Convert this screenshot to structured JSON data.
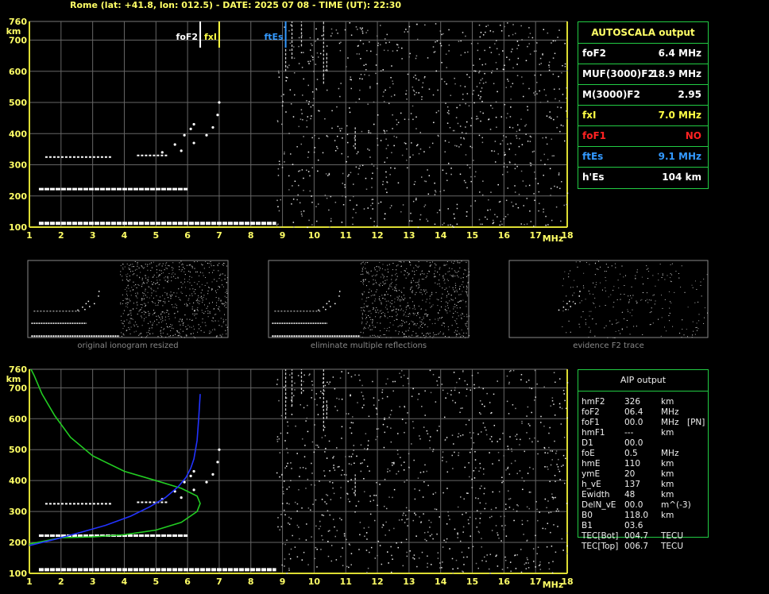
{
  "header": {
    "title": "Rome (lat: +41.8, lon: 012.5) - DATE: 2025 07 08 - TIME (UT): 22:30"
  },
  "autoscala": {
    "title": "AUTOSCALA output",
    "rows": [
      {
        "key": "foF2",
        "value": "6.4 MHz",
        "color": "#ffffff"
      },
      {
        "key": "MUF(3000)F2",
        "value": "18.9 MHz",
        "color": "#ffffff"
      },
      {
        "key": "M(3000)F2",
        "value": "2.95",
        "color": "#ffffff"
      },
      {
        "key": "fxI",
        "value": "7.0 MHz",
        "color": "#ffff44"
      },
      {
        "key": "foF1",
        "value": "NO",
        "color": "#ff2222"
      },
      {
        "key": "ftEs",
        "value": "9.1 MHz",
        "color": "#3399ff"
      },
      {
        "key": "h'Es",
        "value": "104    km",
        "color": "#ffffff"
      }
    ]
  },
  "aip": {
    "title": "AIP output",
    "rows": [
      [
        "hmF2",
        "326",
        "km",
        ""
      ],
      [
        "foF2",
        "06.4",
        "MHz",
        ""
      ],
      [
        "foF1",
        "00.0",
        "MHz",
        "[PN]"
      ],
      [
        "hmF1",
        "---",
        "km",
        ""
      ],
      [
        "D1",
        "00.0",
        "",
        ""
      ],
      [
        "foE",
        "0.5",
        "MHz",
        ""
      ],
      [
        "hmE",
        "110",
        "km",
        ""
      ],
      [
        "ymE",
        "20",
        "km",
        ""
      ],
      [
        "h_vE",
        "137",
        "km",
        ""
      ],
      [
        "Ewidth",
        "48",
        "km",
        ""
      ],
      [
        "DelN_vE",
        "00.0",
        "m^(-3)",
        ""
      ],
      [
        "B0",
        "118.0",
        "km",
        ""
      ],
      [
        "B1",
        "03.6",
        "",
        ""
      ],
      [
        "TEC[Bot]",
        "004.7",
        "TECU",
        ""
      ],
      [
        "TEC[Top]",
        "006.7",
        "TECU",
        ""
      ]
    ]
  },
  "thumbnails": {
    "captions": [
      "original ionogram resized",
      "eliminate multiple reflections",
      "evidence F2 trace"
    ]
  },
  "chart_data": [
    {
      "type": "scatter",
      "title": "",
      "xlabel": "MHz",
      "ylabel": "km",
      "xlim": [
        1,
        18
      ],
      "ylim": [
        100,
        760
      ],
      "x_ticks": [
        1,
        2,
        3,
        4,
        5,
        6,
        7,
        8,
        9,
        10,
        11,
        12,
        13,
        14,
        15,
        16,
        17,
        18
      ],
      "y_ticks": [
        100,
        200,
        300,
        400,
        500,
        600,
        700,
        760
      ],
      "grid": true,
      "markers": [
        {
          "name": "foF2",
          "x": 6.4,
          "color": "#ffffff"
        },
        {
          "name": "fxI",
          "x": 7.0,
          "color": "#ffff44"
        },
        {
          "name": "ftEs",
          "x": 9.1,
          "color": "#3399ff"
        }
      ],
      "traces": [
        {
          "x": [
            1.3,
            8.8
          ],
          "y": 112
        },
        {
          "x": [
            1.3,
            6.0
          ],
          "y": 222
        },
        {
          "x": [
            1.5,
            3.6
          ],
          "y": 325
        },
        {
          "x": [
            4.4,
            5.4
          ],
          "y": 330
        }
      ],
      "f2_trace_o": [
        [
          5.2,
          340
        ],
        [
          5.6,
          365
        ],
        [
          5.9,
          395
        ],
        [
          6.1,
          415
        ],
        [
          6.2,
          430
        ]
      ],
      "f2_trace_x": [
        [
          5.8,
          345
        ],
        [
          6.2,
          370
        ],
        [
          6.6,
          395
        ],
        [
          6.8,
          420
        ],
        [
          6.95,
          460
        ],
        [
          7.0,
          500
        ]
      ]
    },
    {
      "type": "line",
      "title": "",
      "xlabel": "MHz",
      "ylabel": "km",
      "xlim": [
        1,
        18
      ],
      "ylim": [
        100,
        760
      ],
      "x_ticks": [
        1,
        2,
        3,
        4,
        5,
        6,
        7,
        8,
        9,
        10,
        11,
        12,
        13,
        14,
        15,
        16,
        17,
        18
      ],
      "y_ticks": [
        100,
        200,
        300,
        400,
        500,
        600,
        700,
        760
      ],
      "grid": true,
      "series": [
        {
          "color": "#22cc22",
          "points": [
            [
              1.0,
              195
            ],
            [
              2.0,
              215
            ],
            [
              3.0,
              218
            ],
            [
              4.0,
              225
            ],
            [
              5.0,
              240
            ],
            [
              5.8,
              265
            ],
            [
              6.3,
              300
            ],
            [
              6.4,
              326
            ],
            [
              6.3,
              350
            ],
            [
              5.8,
              375
            ],
            [
              5.0,
              400
            ],
            [
              4.0,
              430
            ],
            [
              3.0,
              480
            ],
            [
              2.3,
              540
            ],
            [
              1.8,
              610
            ],
            [
              1.4,
              680
            ],
            [
              1.15,
              740
            ],
            [
              1.05,
              760
            ]
          ]
        },
        {
          "color": "#2233ff",
          "points": [
            [
              1.0,
              190
            ],
            [
              1.8,
              210
            ],
            [
              2.6,
              232
            ],
            [
              3.4,
              255
            ],
            [
              4.2,
              285
            ],
            [
              4.8,
              315
            ],
            [
              5.3,
              345
            ],
            [
              5.7,
              380
            ],
            [
              5.95,
              410
            ],
            [
              6.1,
              440
            ],
            [
              6.2,
              470
            ],
            [
              6.3,
              530
            ],
            [
              6.35,
              600
            ],
            [
              6.4,
              680
            ]
          ]
        }
      ]
    }
  ]
}
